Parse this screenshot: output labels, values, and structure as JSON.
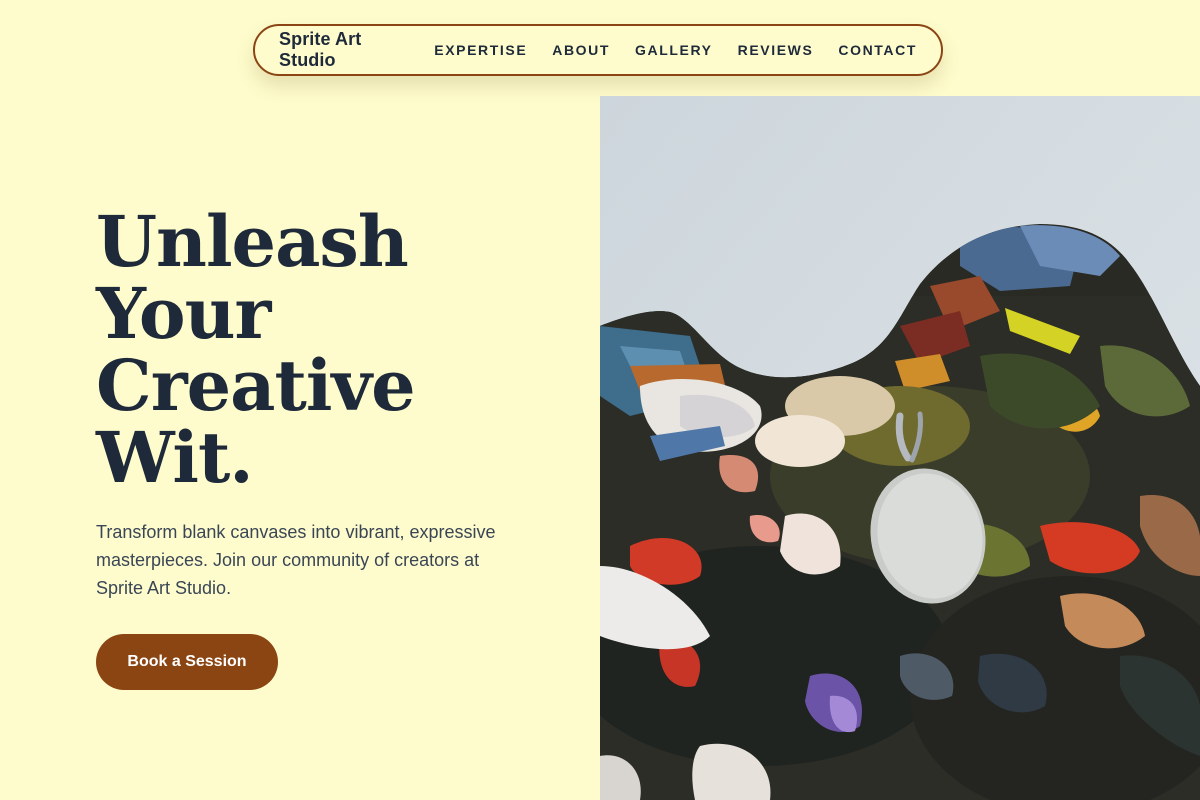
{
  "nav": {
    "brand": "Sprite Art Studio",
    "links": [
      {
        "label": "EXPERTISE"
      },
      {
        "label": "ABOUT"
      },
      {
        "label": "GALLERY"
      },
      {
        "label": "REVIEWS"
      },
      {
        "label": "CONTACT"
      }
    ]
  },
  "hero": {
    "title_lines": [
      "Unleash",
      "Your",
      "Creative",
      "Wit."
    ],
    "description": "Transform blank canvases into vibrant, expressive masterpieces. Join our community of creators at Sprite Art Studio.",
    "cta_label": "Book a Session",
    "image_alt": "Artist's paint palette covered in layers of colorful oil paint"
  },
  "colors": {
    "background": "#fefccc",
    "accent": "#8b4513",
    "text": "#1e2a3a"
  }
}
